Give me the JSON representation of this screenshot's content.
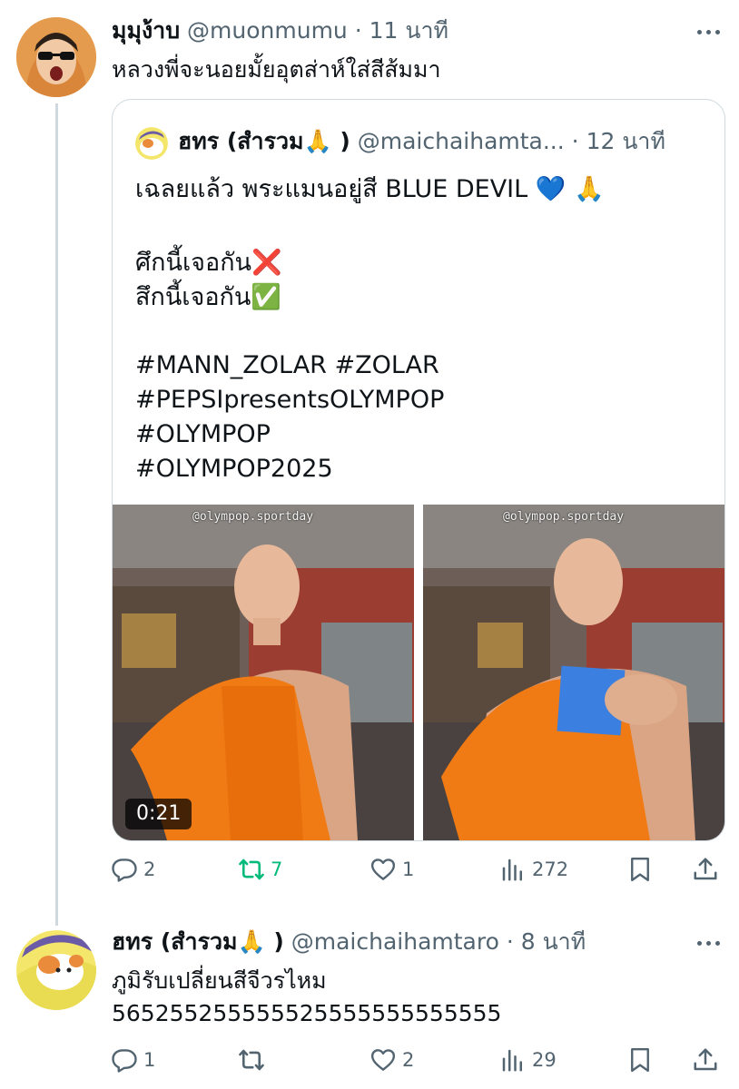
{
  "tweet1": {
    "display_name": "มุมุง้าบ",
    "handle": "@muonmumu",
    "time": "· 11 นาที",
    "text": "หลวงพี่จะนอยมั้ยอุตส่าห์ใส่สีส้มมา",
    "quote": {
      "display_name": "ฮทร (สำรวม🙏 )",
      "handle": "@maichaihamta...",
      "time": "· 12 นาที",
      "lines": [
        "เฉลยแล้ว พระแมนอยู่สี BLUE DEVIL 💙 🙏",
        "",
        "ศึกนี้เจอกัน❌",
        "สึกนี้เจอกัน✅",
        "",
        "#MANN_ZOLAR #ZOLAR",
        "#PEPSIpresentsOLYMPOP",
        "#OLYMPOP",
        "#OLYMPOP2025"
      ],
      "media": {
        "watermark": "@olympop.sportday",
        "duration": "0:21"
      }
    },
    "actions": {
      "replies": "2",
      "retweets": "7",
      "likes": "1",
      "views": "272"
    }
  },
  "tweet2": {
    "display_name": "ฮทร (สำรวม🙏 )",
    "handle": "@maichaihamtaro",
    "time": "· 8 นาที",
    "lines": [
      "ภูมิรับเปลี่ยนสีจีวรไหม",
      "565255255555525555555555555"
    ],
    "actions": {
      "replies": "1",
      "retweets": "",
      "likes": "2",
      "views": "29"
    }
  },
  "colors": {
    "text_primary": "#0f1419",
    "text_secondary": "#536471",
    "retweet_active": "#00ba7c",
    "border": "#cfd9de",
    "robe": "#f07a14"
  },
  "icons": [
    "more-icon",
    "reply-icon",
    "retweet-icon",
    "like-icon",
    "views-icon",
    "bookmark-icon",
    "share-icon"
  ]
}
